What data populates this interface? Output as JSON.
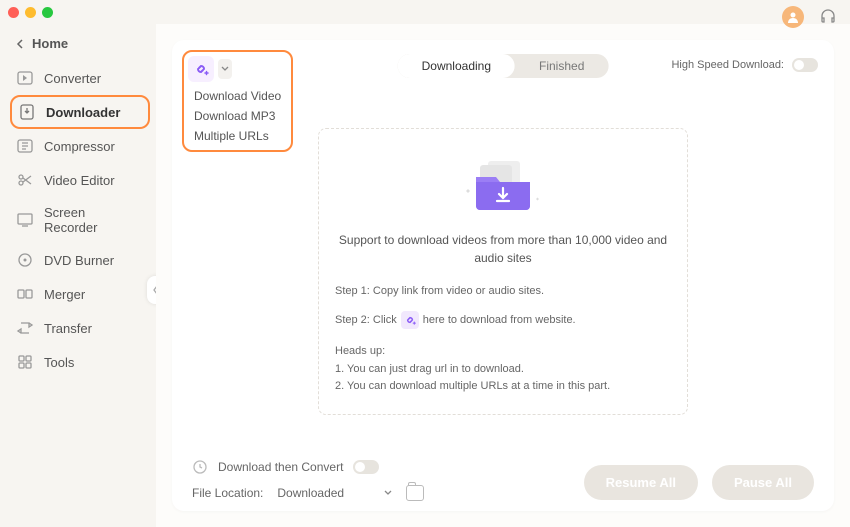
{
  "sidebar": {
    "home": "Home",
    "items": [
      {
        "label": "Converter"
      },
      {
        "label": "Downloader"
      },
      {
        "label": "Compressor"
      },
      {
        "label": "Video Editor"
      },
      {
        "label": "Screen Recorder"
      },
      {
        "label": "DVD Burner"
      },
      {
        "label": "Merger"
      },
      {
        "label": "Transfer"
      },
      {
        "label": "Tools"
      }
    ]
  },
  "dropdown": {
    "download_video": "Download Video",
    "download_mp3": "Download MP3",
    "multiple_urls": "Multiple URLs"
  },
  "tabs": {
    "downloading": "Downloading",
    "finished": "Finished"
  },
  "hsd_label": "High Speed Download:",
  "dropzone": {
    "support": "Support to download videos from more than 10,000 video and audio sites",
    "step1": "Step 1: Copy link from video or audio sites.",
    "step2_a": "Step 2: Click",
    "step2_b": "here to download from website.",
    "heads_title": "Heads up:",
    "heads_1": "1. You can just drag url in to download.",
    "heads_2": "2. You can download multiple URLs at a time in this part."
  },
  "bottom": {
    "convert_label": "Download then Convert",
    "location_label": "File Location:",
    "location_value": "Downloaded",
    "resume": "Resume All",
    "pause": "Pause All"
  }
}
